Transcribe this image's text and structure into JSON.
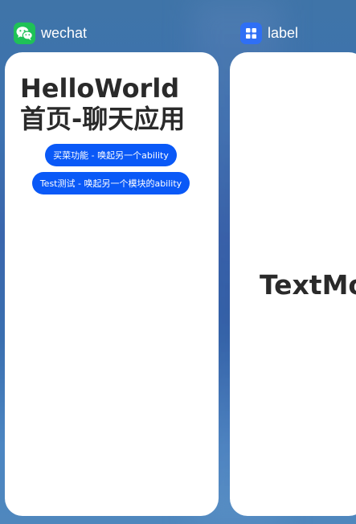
{
  "tasks": [
    {
      "app_name": "wechat",
      "icon": "wechat-icon",
      "icon_color": "#1fc157",
      "page": {
        "title": "HelloWorld 首页-聊天应用",
        "buttons": [
          "买菜功能 - 唤起另一个ability",
          "Test测试 - 唤起另一个模块的ability"
        ]
      }
    },
    {
      "app_name": "label",
      "icon": "grid-icon",
      "icon_color": "#2f6ff5",
      "page": {
        "title": "TextModel"
      }
    }
  ],
  "colors": {
    "button_bg": "#0a59f7",
    "title_text": "#2a2a2a"
  }
}
